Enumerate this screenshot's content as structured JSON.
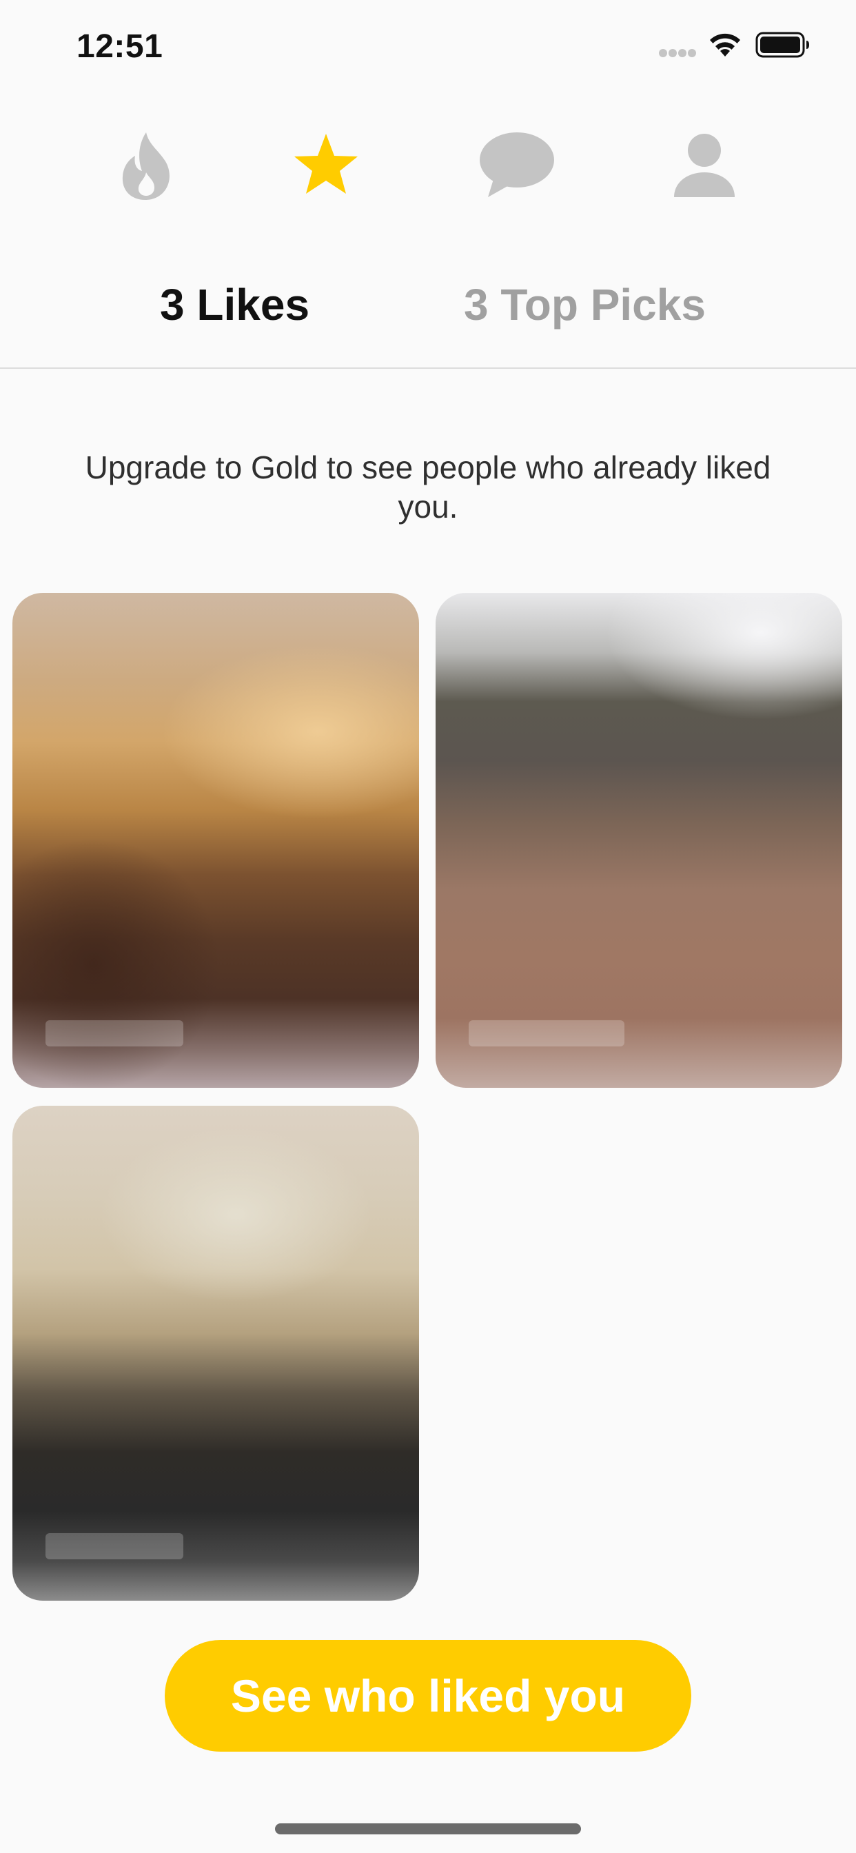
{
  "status_bar": {
    "time": "12:51",
    "icons": [
      "signal-dots-icon",
      "wifi-icon",
      "battery-icon"
    ]
  },
  "nav": {
    "items": [
      {
        "icon": "flame-icon",
        "active": false
      },
      {
        "icon": "star-icon",
        "active": true
      },
      {
        "icon": "chat-bubble-icon",
        "active": false
      },
      {
        "icon": "profile-icon",
        "active": false
      }
    ]
  },
  "tabs": [
    {
      "label": "3 Likes",
      "active": true
    },
    {
      "label": "3 Top Picks",
      "active": false
    }
  ],
  "upgrade_message": "Upgrade to Gold to see people who already liked you.",
  "liked_cards": [
    {
      "blurred": true
    },
    {
      "blurred": true
    },
    {
      "blurred": true
    }
  ],
  "cta_label": "See who liked you",
  "colors": {
    "accent": "#ffcc00",
    "inactive_icon": "#c4c4c4",
    "active_tab": "#111111",
    "inactive_tab": "#a0a0a0",
    "background": "#fafafa"
  }
}
